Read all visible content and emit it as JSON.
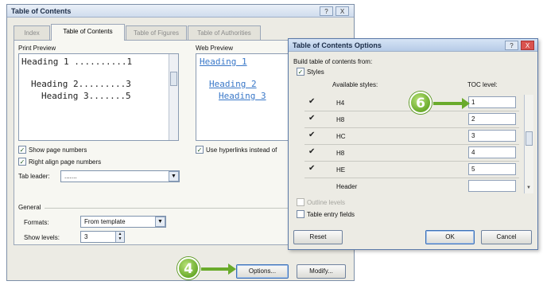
{
  "toc_dialog": {
    "title": "Table of Contents",
    "help_label": "?",
    "close_label": "X",
    "tabs": [
      {
        "label": "Index"
      },
      {
        "label": "Table of Contents"
      },
      {
        "label": "Table of Figures"
      },
      {
        "label": "Table of Authorities"
      }
    ],
    "print_preview": {
      "label": "Print Preview",
      "lines": [
        "Heading 1 ..........1",
        "Heading 2.........3",
        "Heading 3.......5"
      ]
    },
    "web_preview": {
      "label": "Web Preview",
      "lines": [
        "Heading 1",
        "Heading 2",
        "Heading 3"
      ]
    },
    "show_page_numbers": {
      "label": "Show page numbers",
      "checked": true
    },
    "right_align": {
      "label": "Right align page numbers",
      "checked": true
    },
    "tab_leader": {
      "label": "Tab leader:",
      "value": "......."
    },
    "use_hyperlinks": {
      "label": "Use hyperlinks instead of",
      "checked": true
    },
    "general": {
      "label": "General",
      "formats_label": "Formats:",
      "formats_value": "From template",
      "show_levels_label": "Show levels:",
      "show_levels_value": "3"
    },
    "options_button": "Options...",
    "modify_button": "Modify..."
  },
  "options_dialog": {
    "title": "Table of Contents Options",
    "help_label": "?",
    "close_label": "X",
    "build_from_label": "Build table of contents from:",
    "styles": {
      "label": "Styles",
      "checked": true
    },
    "available_styles_header": "Available styles:",
    "toc_level_header": "TOC level:",
    "rows": [
      {
        "name": "H4",
        "checked": true,
        "level": "1"
      },
      {
        "name": "H8",
        "checked": true,
        "level": "2"
      },
      {
        "name": "HC",
        "checked": true,
        "level": "3"
      },
      {
        "name": "H8",
        "checked": true,
        "level": "4"
      },
      {
        "name": "HE",
        "checked": true,
        "level": "5"
      },
      {
        "name": "Header",
        "checked": false,
        "level": ""
      }
    ],
    "outline_levels": {
      "label": "Outline levels",
      "checked": false
    },
    "table_entry_fields": {
      "label": "Table entry fields",
      "checked": false
    },
    "reset_button": "Reset",
    "ok_button": "OK",
    "cancel_button": "Cancel"
  },
  "callouts": [
    {
      "number": "4"
    },
    {
      "number": "6"
    }
  ],
  "colors": {
    "callout": "#6aab2b",
    "title_text": "#1c2d48",
    "hyperlink": "#3a78c8"
  }
}
